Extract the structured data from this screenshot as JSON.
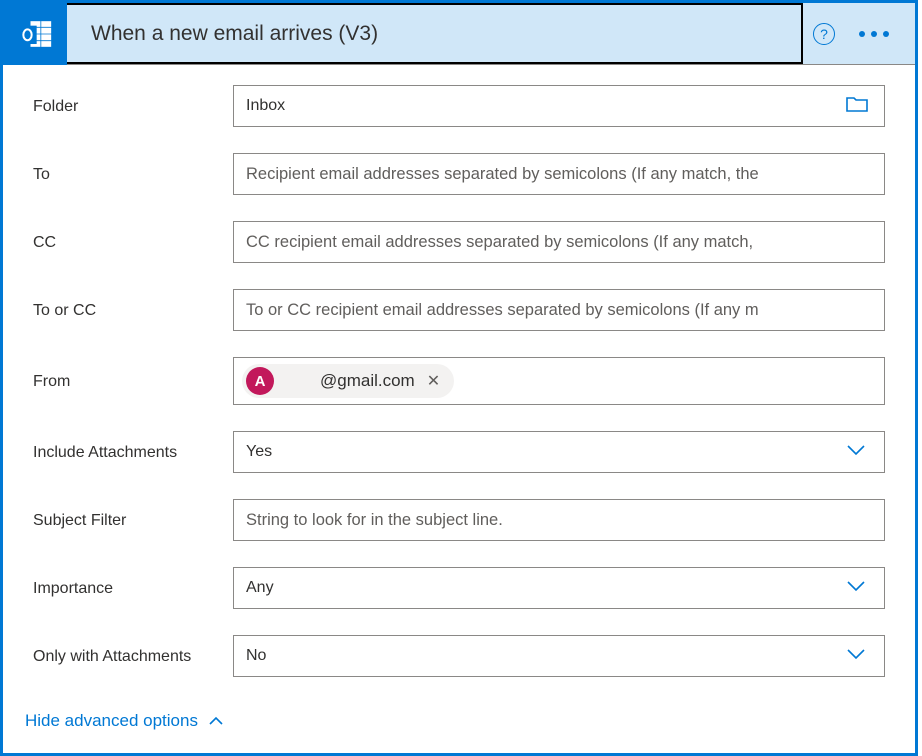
{
  "header": {
    "title": "When a new email arrives (V3)"
  },
  "fields": {
    "folder": {
      "label": "Folder",
      "value": "Inbox"
    },
    "to": {
      "label": "To",
      "placeholder": "Recipient email addresses separated by semicolons (If any match, the"
    },
    "cc": {
      "label": "CC",
      "placeholder": "CC recipient email addresses separated by semicolons (If any match,"
    },
    "to_or_cc": {
      "label": "To or CC",
      "placeholder": "To or CC recipient email addresses separated by semicolons (If any m"
    },
    "from": {
      "label": "From",
      "token": {
        "avatar_initial": "A",
        "text": "@gmail.com"
      }
    },
    "include_attachments": {
      "label": "Include Attachments",
      "value": "Yes"
    },
    "subject_filter": {
      "label": "Subject Filter",
      "placeholder": "String to look for in the subject line."
    },
    "importance": {
      "label": "Importance",
      "value": "Any"
    },
    "only_with_attachments": {
      "label": "Only with Attachments",
      "value": "No"
    }
  },
  "footer": {
    "advanced_link": "Hide advanced options"
  }
}
